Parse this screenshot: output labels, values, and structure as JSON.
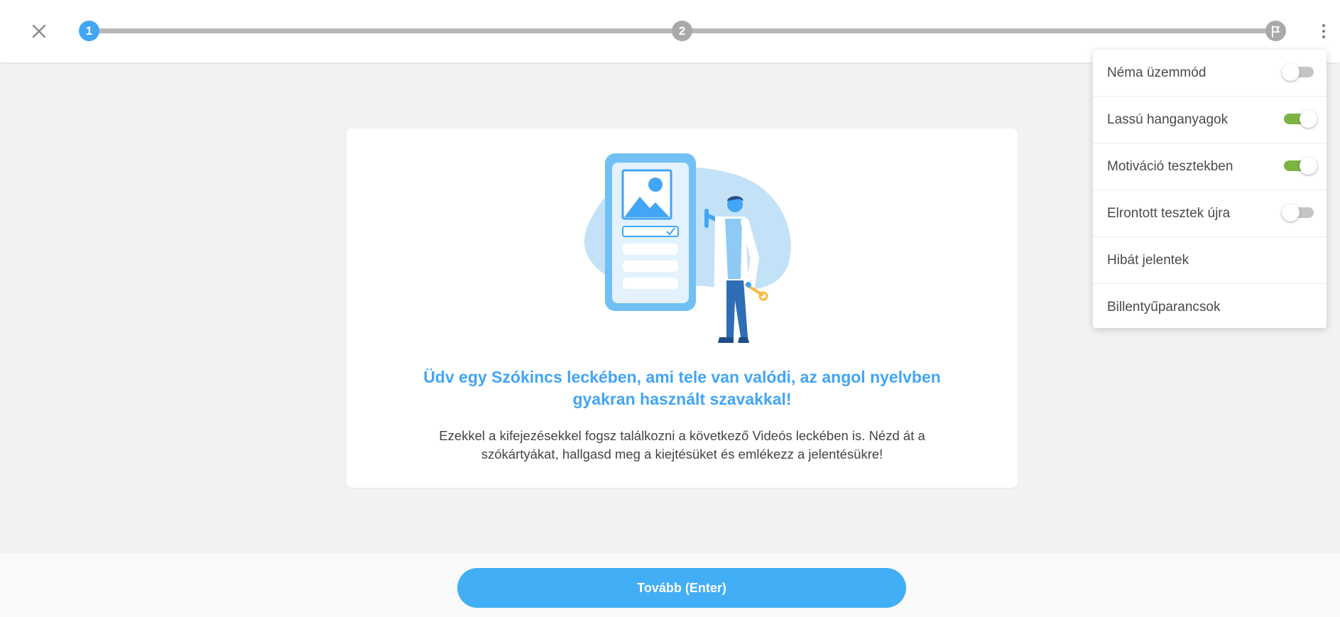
{
  "progress": {
    "steps": [
      {
        "label": "1",
        "state": "active"
      },
      {
        "label": "2",
        "state": "inactive"
      },
      {
        "label": "",
        "state": "finish"
      }
    ]
  },
  "card": {
    "title": "Üdv egy Szókincs leckében, ami tele van valódi, az angol nyelvben gyakran használt szavakkal!",
    "text": "Ezekkel a kifejezésekkel fogsz találkozni a következő Videós leckében is. Nézd át a szókártyákat, hallgasd meg a kiejtésüket és emlékezz a jelentésükre!"
  },
  "footer": {
    "next_label": "Tovább (Enter)"
  },
  "menu": {
    "items": [
      {
        "label": "Néma üzemmód",
        "toggle": false
      },
      {
        "label": "Lassú hanganyagok",
        "toggle": true
      },
      {
        "label": "Motiváció tesztekben",
        "toggle": true
      },
      {
        "label": "Elrontott tesztek újra",
        "toggle": false
      },
      {
        "label": "Hibát jelentek"
      },
      {
        "label": "Billentyűparancsok"
      }
    ]
  },
  "colors": {
    "accent": "#42a5f5",
    "toggle_on": "#7cb342",
    "toggle_off": "#c4c4c4",
    "step_inactive": "#a9a9a9"
  },
  "icons": [
    "close-icon",
    "flag-icon",
    "more-vert-icon"
  ]
}
